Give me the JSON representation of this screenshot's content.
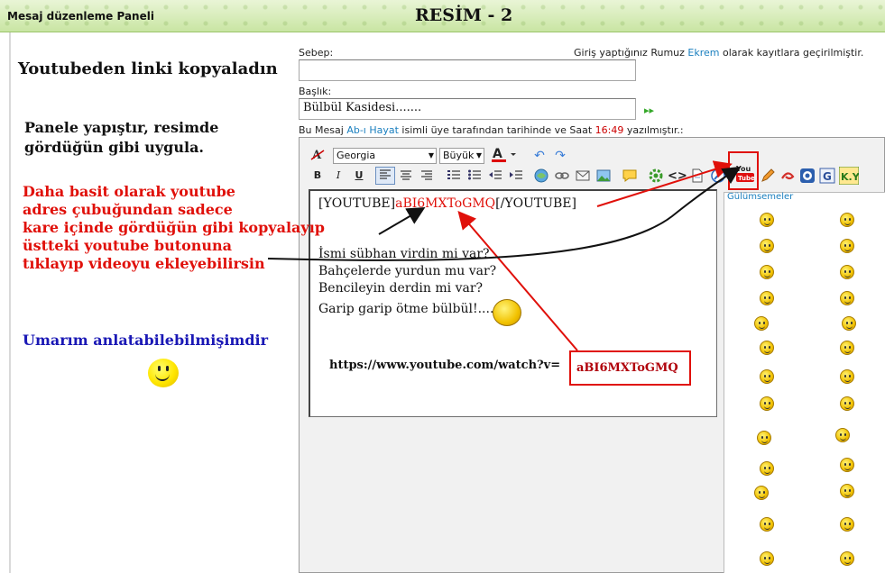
{
  "header": {
    "panel_title": "Mesaj düzenleme Paneli",
    "center_title": "RESİM - 2"
  },
  "form": {
    "reason_label": "Sebep:",
    "reason_value": "",
    "login_prefix": "Giriş yaptığınız Rumuz ",
    "login_user": "Ekrem",
    "login_suffix": " olarak kayıtlara geçirilmiştir.",
    "title_label": "Başlık:",
    "title_value": "Bülbül Kasidesi.......",
    "msg_prefix": "Bu Mesaj ",
    "msg_user": "Ab-ı Hayat",
    "msg_mid": " isimli üye tarafından tarihinde ve Saat ",
    "msg_time": "16:49",
    "msg_suffix": " yazılmıştır.:"
  },
  "toolbar": {
    "font_value": "Georgia",
    "size_value": "Büyük",
    "bold": "B",
    "italic": "I",
    "underline": "U",
    "code": "<>",
    "youtube_label": "You",
    "ky_label": "K.Y",
    "g_label": "G"
  },
  "editor": {
    "yt_open": "[YOUTUBE]",
    "yt_id": "aBI6MXToGMQ",
    "yt_close": "[/YOUTUBE]",
    "lines": [
      "İsmi sübhan virdin mi var?",
      "Bahçelerde yurdun mu var?",
      "Bencileyin derdin mi var?",
      "Garip garip ötme bülbül!...."
    ]
  },
  "smilies": {
    "title": "Gülümsemeler"
  },
  "annotations": {
    "step1": "Youtubeden linki kopyaladın",
    "step2_line1": "Panele yapıştır, resimde",
    "step2_line2": "gördüğün gibi uygula.",
    "tip_lines": [
      "Daha basit olarak youtube",
      "adres çubuğundan sadece",
      "kare içinde gördüğün gibi kopyalayıp",
      "üstteki youtube butonuna",
      "tıklayıp videoyu ekleyebilirsin"
    ],
    "closing": "Umarım anlatabilebilmişimdir",
    "url_prefix": "https://www.youtube.com/watch?v=",
    "url_id": "aBI6MXToGMQ"
  },
  "colors": {
    "annotation_red": "#e0100a",
    "annotation_blue": "#1a18b5",
    "link_blue": "#1a7fbf",
    "header_green": "#c9e5a3"
  }
}
